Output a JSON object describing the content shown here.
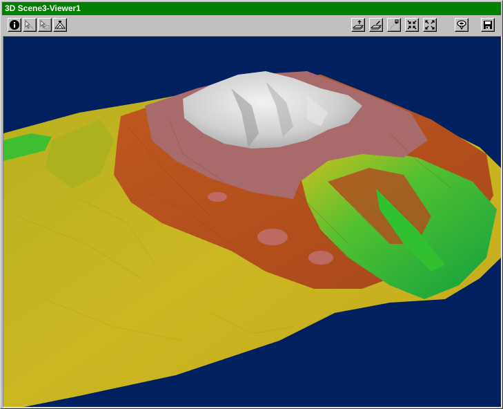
{
  "window": {
    "title": "3D Scene3-Viewer1"
  },
  "toolbar": {
    "left_icons": [
      "info-icon",
      "select-pointer-icon",
      "select-region-icon",
      "scene-properties-icon"
    ],
    "right_icons": [
      "extrude-layer-icon",
      "edit-layer-icon",
      "navigate-icon",
      "zoom-in-icon",
      "zoom-out-icon",
      "rotate-icon",
      "save-icon"
    ]
  },
  "colors": {
    "titlebar": "#008000",
    "viewport_background": "#00205f",
    "terrain_low": "#c8b820",
    "terrain_green": "#3fbf2f",
    "terrain_mid": "#b8501e",
    "terrain_high": "#a86a6a",
    "terrain_peak": "#d4d4d4"
  }
}
